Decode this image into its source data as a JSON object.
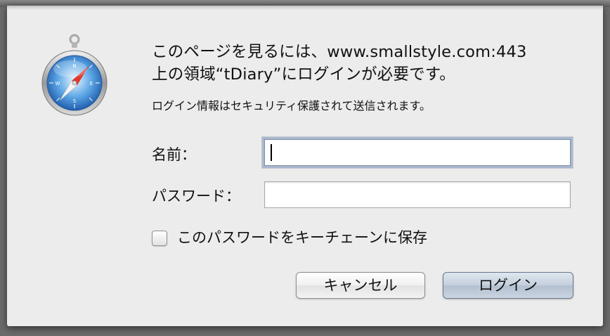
{
  "dialog": {
    "message_line1": "このページを見るには、www.smallstyle.com:443",
    "message_line2": "上の領域“tDiary”にログインが必要です。",
    "secure_note": "ログイン情報はセキュリティ保護されて送信されます。"
  },
  "fields": {
    "name_label": "名前：",
    "name_value": "",
    "password_label": "パスワード：",
    "password_value": ""
  },
  "keychain": {
    "label": "このパスワードをキーチェーンに保存",
    "checked": false
  },
  "buttons": {
    "cancel_label": "キャンセル",
    "login_label": "ログイン"
  },
  "icon": {
    "name": "safari-compass-icon"
  }
}
